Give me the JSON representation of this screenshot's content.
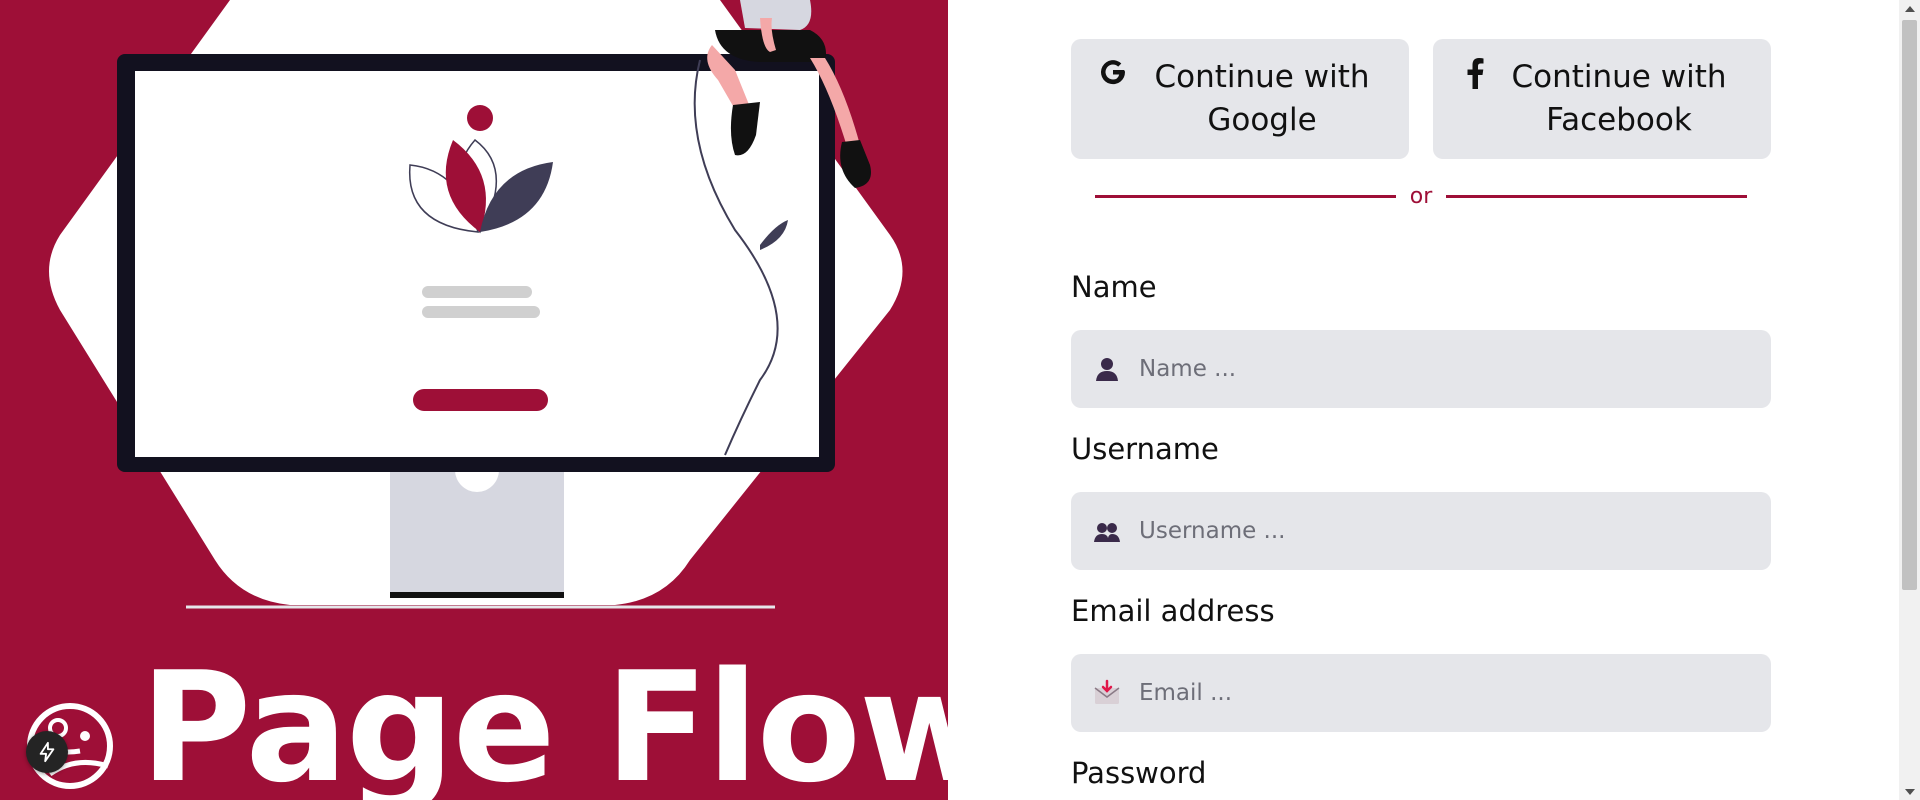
{
  "theme": {
    "brand": "#9e0f37",
    "field_bg": "#e5e6ea"
  },
  "brand": {
    "title": "Page Flow"
  },
  "social": {
    "google": {
      "icon": "google-g-icon",
      "label": "Continue with Google"
    },
    "facebook": {
      "icon": "facebook-f-icon",
      "label": "Continue with Facebook"
    }
  },
  "divider": {
    "text": "or"
  },
  "form": {
    "name": {
      "label": "Name",
      "placeholder": "Name ...",
      "icon": "user-icon"
    },
    "username": {
      "label": "Username",
      "placeholder": "Username ...",
      "icon": "users-icon"
    },
    "email": {
      "label": "Email address",
      "placeholder": "Email ...",
      "icon": "envelope-icon"
    },
    "password": {
      "label": "Password"
    }
  },
  "floating_button": {
    "icon": "lightning-icon"
  }
}
